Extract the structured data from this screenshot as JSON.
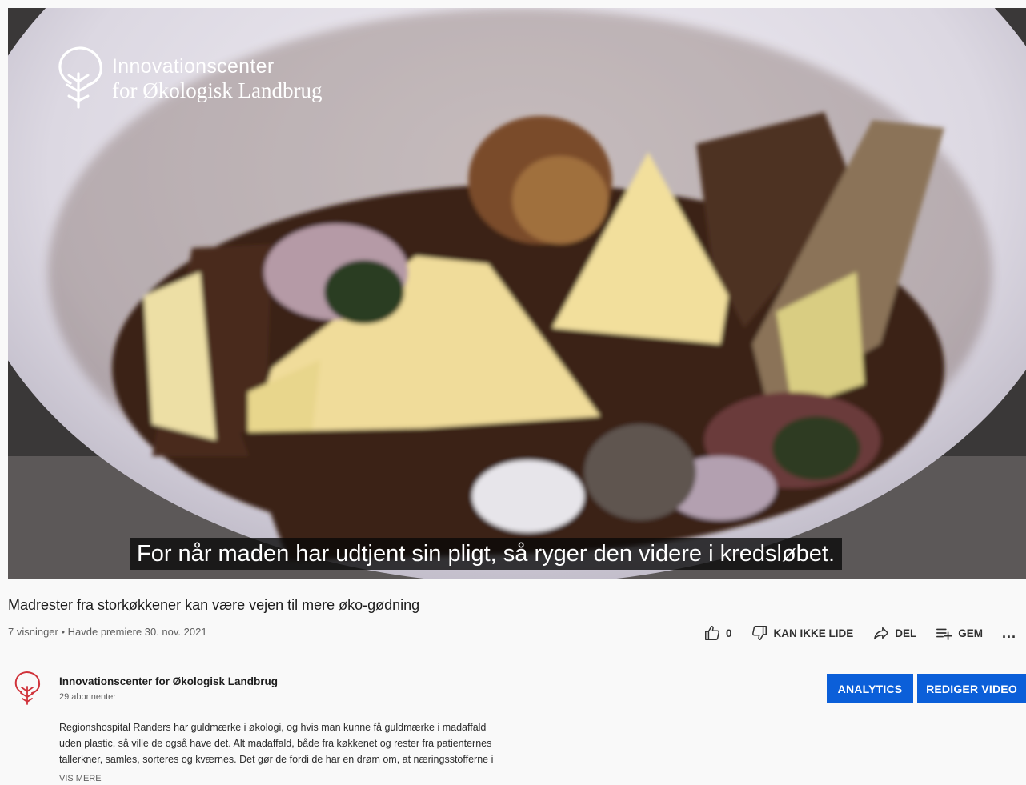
{
  "player": {
    "logo_line1": "Innovationscenter",
    "logo_line2": "for Økologisk Landbrug",
    "caption": "For når maden har udtjent sin pligt, så ryger den videre i kredsløbet."
  },
  "video": {
    "title": "Madrester fra storkøkkener kan være vejen til mere øko-gødning",
    "meta": "7 visninger • Havde premiere 30. nov. 2021"
  },
  "actions": {
    "like_count": "0",
    "dislike_label": "KAN IKKE LIDE",
    "share_label": "DEL",
    "save_label": "GEM",
    "more_label": "..."
  },
  "channel": {
    "name": "Innovationscenter for Økologisk Landbrug",
    "subscribers": "29 abonnenter",
    "analytics_label": "ANALYTICS",
    "edit_label": "REDIGER VIDEO",
    "avatar_color": "#d0323a"
  },
  "description": {
    "lines": [
      "Regionshospital Randers har guldmærke i økologi, og hvis man kunne få guldmærke i madaffald",
      "uden plastic, så ville de også have det. Alt madaffald, både fra køkkenet og rester fra patienternes",
      "tallerkner, samles, sorteres og kværnes. Det gør de fordi de har en drøm om, at næringsstofferne i"
    ],
    "show_more": "VIS MERE"
  },
  "colors": {
    "accent": "#0b5fd9",
    "background": "#f9f9f9"
  },
  "icons": {
    "like": "thumbs-up-icon",
    "dislike": "thumbs-down-icon",
    "share": "share-arrow-icon",
    "save": "playlist-add-icon",
    "more": "more-dots-icon"
  }
}
